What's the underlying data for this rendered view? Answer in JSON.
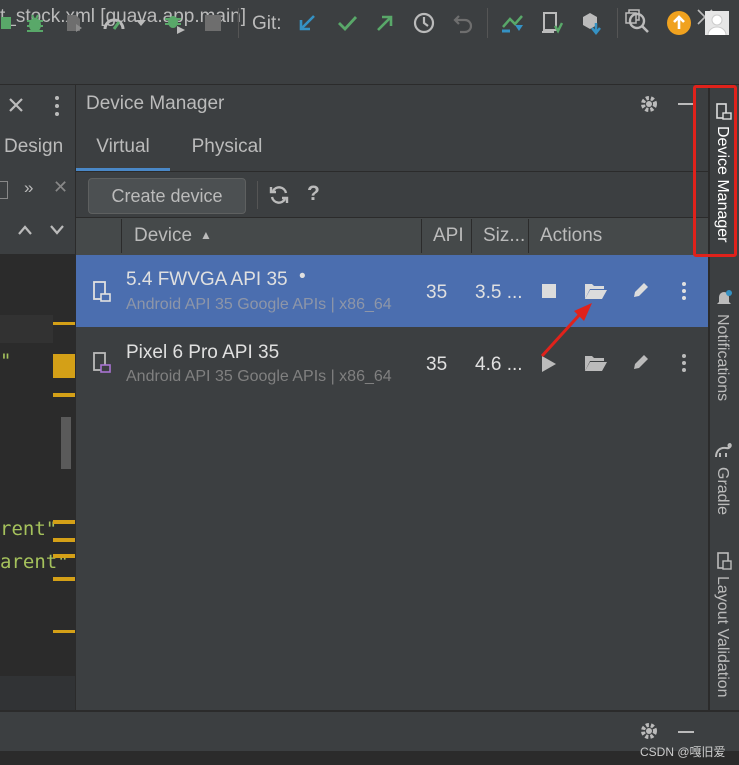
{
  "window": {
    "title": "t_stock.xml [guava.app.main]",
    "restore_icon": "restore-icon",
    "close_icon": "close-icon"
  },
  "toolbar": {
    "git_label": "Git:",
    "icons": [
      "bug-icon",
      "profile-icon",
      "gauge-icon",
      "attach-debugger-icon",
      "stop-icon",
      "git-update-icon",
      "git-commit-icon",
      "git-push-icon",
      "history-icon",
      "rollback-icon",
      "sync-icon",
      "device-file-icon",
      "sdk-icon",
      "search-icon",
      "update-icon",
      "avatar-icon"
    ]
  },
  "editor": {
    "tab_design": "Design",
    "code_lines": [
      "\"",
      "rent\"",
      "arent\""
    ]
  },
  "device_manager": {
    "title": "Device Manager",
    "tabs": [
      "Virtual",
      "Physical"
    ],
    "create_device": "Create device",
    "help_glyph": "?",
    "columns": {
      "device": "Device",
      "api": "API",
      "size": "Siz...",
      "actions": "Actions"
    },
    "sort_glyph": "▲",
    "devices": [
      {
        "name": "5.4  FWVGA API 35",
        "running_dot": "•",
        "subtitle": "Android API 35 Google APIs | x86_64",
        "api": "35",
        "size": "3.5 ...",
        "selected": true,
        "primary_action": "stop"
      },
      {
        "name": "Pixel 6 Pro API 35",
        "running_dot": "",
        "subtitle": "Android API 35 Google APIs | x86_64",
        "api": "35",
        "size": "4.6 ...",
        "selected": false,
        "primary_action": "play"
      }
    ]
  },
  "right_stripe": {
    "tabs": [
      "Device Manager",
      "Notifications",
      "Gradle",
      "Layout Validation"
    ]
  },
  "watermark": "CSDN @嘎旧爱",
  "colors": {
    "selected_row": "#4b6eaf",
    "annotation": "#e0221b",
    "accent": "#4a88c7"
  }
}
